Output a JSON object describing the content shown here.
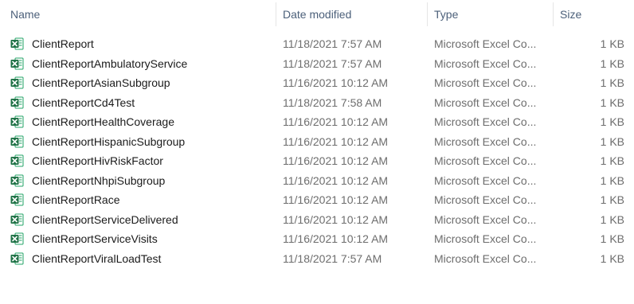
{
  "columns": {
    "name": "Name",
    "date": "Date modified",
    "type": "Type",
    "size": "Size"
  },
  "files": [
    {
      "name": "ClientReport",
      "date": "11/18/2021 7:57 AM",
      "type": "Microsoft Excel Co...",
      "size": "1 KB"
    },
    {
      "name": "ClientReportAmbulatoryService",
      "date": "11/18/2021 7:57 AM",
      "type": "Microsoft Excel Co...",
      "size": "1 KB"
    },
    {
      "name": "ClientReportAsianSubgroup",
      "date": "11/16/2021 10:12 AM",
      "type": "Microsoft Excel Co...",
      "size": "1 KB"
    },
    {
      "name": "ClientReportCd4Test",
      "date": "11/18/2021 7:58 AM",
      "type": "Microsoft Excel Co...",
      "size": "1 KB"
    },
    {
      "name": "ClientReportHealthCoverage",
      "date": "11/16/2021 10:12 AM",
      "type": "Microsoft Excel Co...",
      "size": "1 KB"
    },
    {
      "name": "ClientReportHispanicSubgroup",
      "date": "11/16/2021 10:12 AM",
      "type": "Microsoft Excel Co...",
      "size": "1 KB"
    },
    {
      "name": "ClientReportHivRiskFactor",
      "date": "11/16/2021 10:12 AM",
      "type": "Microsoft Excel Co...",
      "size": "1 KB"
    },
    {
      "name": "ClientReportNhpiSubgroup",
      "date": "11/16/2021 10:12 AM",
      "type": "Microsoft Excel Co...",
      "size": "1 KB"
    },
    {
      "name": "ClientReportRace",
      "date": "11/16/2021 10:12 AM",
      "type": "Microsoft Excel Co...",
      "size": "1 KB"
    },
    {
      "name": "ClientReportServiceDelivered",
      "date": "11/16/2021 10:12 AM",
      "type": "Microsoft Excel Co...",
      "size": "1 KB"
    },
    {
      "name": "ClientReportServiceVisits",
      "date": "11/16/2021 10:12 AM",
      "type": "Microsoft Excel Co...",
      "size": "1 KB"
    },
    {
      "name": "ClientReportViralLoadTest",
      "date": "11/18/2021 7:57 AM",
      "type": "Microsoft Excel Co...",
      "size": "1 KB"
    }
  ],
  "icon": "excel-csv-file-icon",
  "colors": {
    "excel_green": "#1e7145",
    "header_text": "#4c607a",
    "row_hover": "#e5f3ff"
  }
}
